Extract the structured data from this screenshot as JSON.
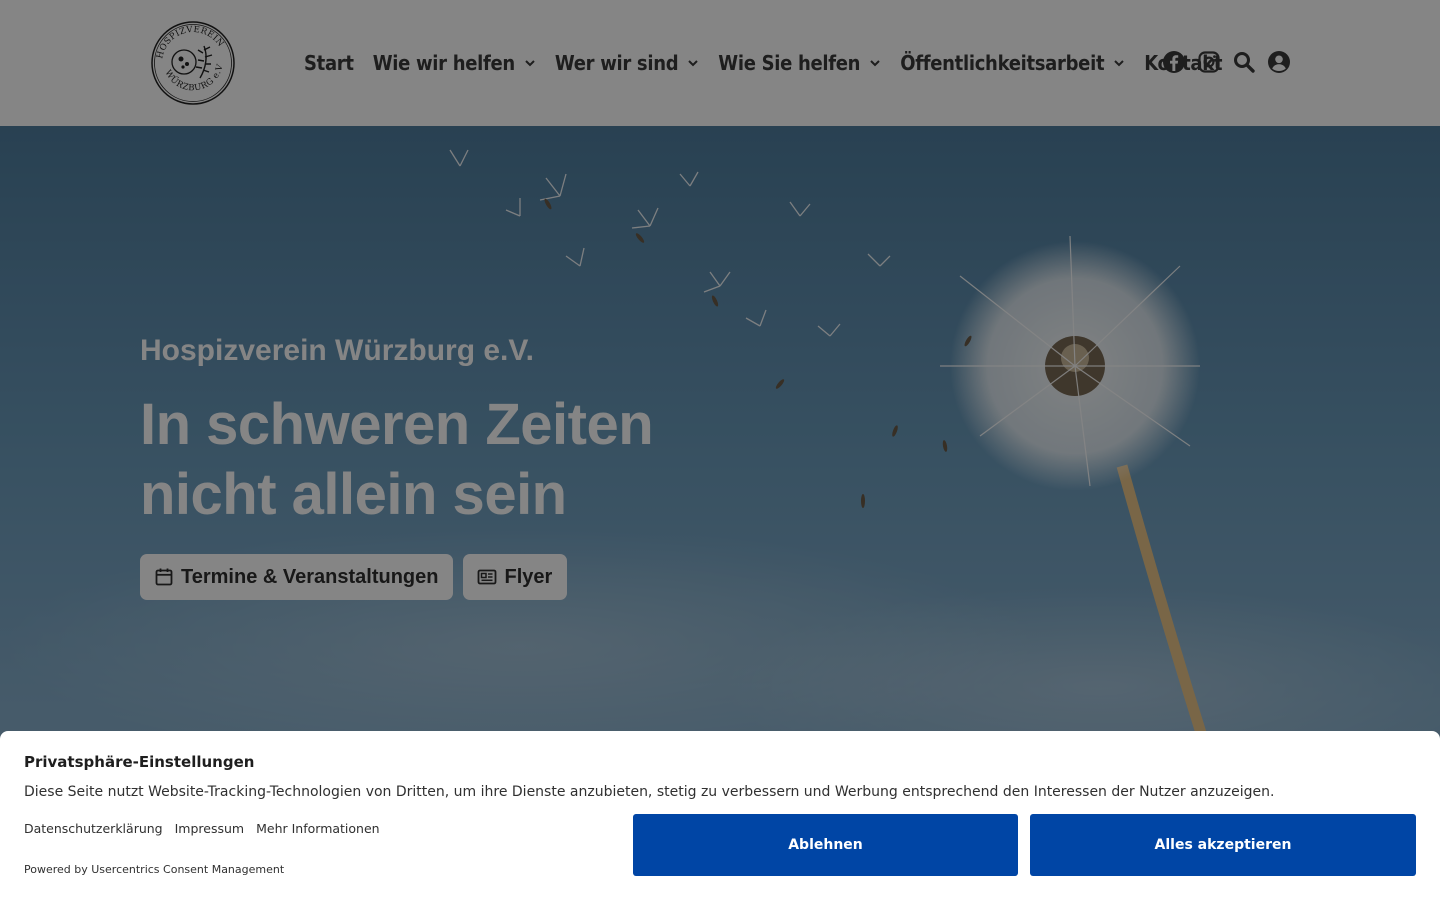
{
  "header": {
    "logo_text_top": "HOSPIZVEREIN",
    "logo_text_bottom": "WÜRZBURG e.V.",
    "nav": [
      {
        "label": "Start",
        "dropdown": false
      },
      {
        "label": "Wie wir helfen",
        "dropdown": true
      },
      {
        "label": "Wer wir sind",
        "dropdown": true
      },
      {
        "label": "Wie Sie helfen",
        "dropdown": true
      },
      {
        "label": "Öffentlichkeitsarbeit",
        "dropdown": true
      },
      {
        "label": "Kontakt",
        "dropdown": false
      }
    ],
    "icons": [
      "facebook-icon",
      "instagram-icon",
      "search-icon",
      "account-icon"
    ]
  },
  "hero": {
    "subtitle": "Hospizverein Würzburg e.V.",
    "title_line1": "In schweren Zeiten",
    "title_line2": "nicht allein sein",
    "buttons": [
      {
        "label": "Termine & Veranstaltungen",
        "icon": "calendar-icon"
      },
      {
        "label": "Flyer",
        "icon": "newspaper-icon"
      }
    ]
  },
  "consent": {
    "title": "Privatsphäre-Einstellungen",
    "text": "Diese Seite nutzt Website-Tracking-Technologien von Dritten, um ihre Dienste anzubieten, stetig zu verbessern und Werbung entsprechend den Interessen der Nutzer anzuzeigen.",
    "links": [
      "Datenschutzerklärung",
      "Impressum",
      "Mehr Informationen"
    ],
    "powered": "Powered by Usercentrics Consent Management",
    "decline_label": "Ablehnen",
    "accept_label": "Alles akzeptieren",
    "button_color": "#0045a5"
  }
}
